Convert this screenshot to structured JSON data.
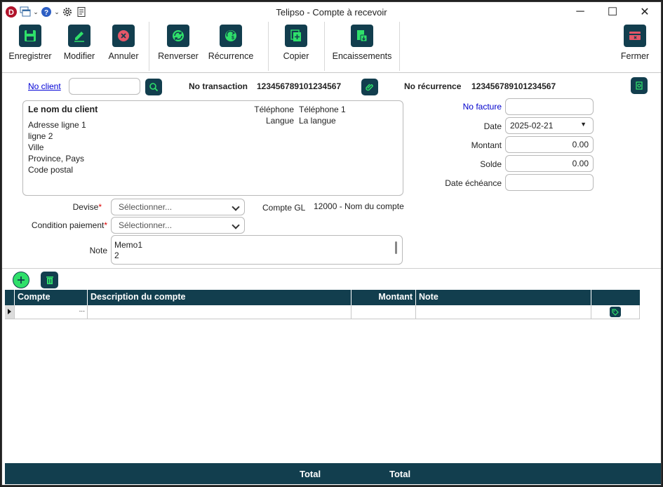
{
  "app": {
    "title": "Telipso - Compte à recevoir",
    "logo_letter": "D"
  },
  "quick_access_icons": [
    "app-logo-icon",
    "windows-icon",
    "help-icon",
    "settings-icon",
    "report-icon"
  ],
  "window_controls": {
    "minimize": "─",
    "maximize": "☐",
    "close": "✕"
  },
  "toolbar": {
    "save": "Enregistrer",
    "modify": "Modifier",
    "cancel": "Annuler",
    "reverse": "Renverser",
    "recurrence": "Récurrence",
    "copy": "Copier",
    "payments": "Encaissements",
    "close": "Fermer"
  },
  "header": {
    "client_no_label": "No client",
    "client_no_value": "",
    "transaction_label": "No transaction",
    "transaction_value": "123456789101234567",
    "recurrence_label": "No récurrence",
    "recurrence_value": "123456789101234567"
  },
  "client": {
    "name": "Le nom du client",
    "address1": "Adresse ligne 1",
    "address2": "ligne 2",
    "city": "Ville",
    "province_country": "Province, Pays",
    "postal": "Code postal",
    "phone_label": "Téléphone",
    "phone_value": "Téléphone 1",
    "lang_label": "Langue",
    "lang_value": "La langue"
  },
  "invoice": {
    "invoice_no_label": "No facture",
    "invoice_no_value": "",
    "date_label": "Date",
    "date_value": "2025-02-21",
    "amount_label": "Montant",
    "amount_value": "0.00",
    "balance_label": "Solde",
    "balance_value": "0.00",
    "due_label": "Date échéance",
    "due_value": ""
  },
  "form": {
    "currency_label": "Devise",
    "currency_placeholder": "Sélectionner...",
    "terms_label": "Condition paiement",
    "terms_placeholder": "Sélectionner...",
    "gl_label": "Compte GL",
    "gl_value": "12000 - Nom du compte",
    "note_label": "Note",
    "note_line1": "Memo1",
    "note_line2": "2",
    "required_mark": "*"
  },
  "grid": {
    "columns": [
      "Compte",
      "Description du compte",
      "Montant",
      "Note"
    ],
    "row_ellipsis": "...",
    "colors": {
      "header": "#123e4e"
    }
  },
  "footer": {
    "total1": "Total",
    "total2": "Total"
  },
  "colors": {
    "accent_dark": "#123e4e",
    "icon_green": "#2fe06a",
    "cancel_red": "#e45668"
  }
}
